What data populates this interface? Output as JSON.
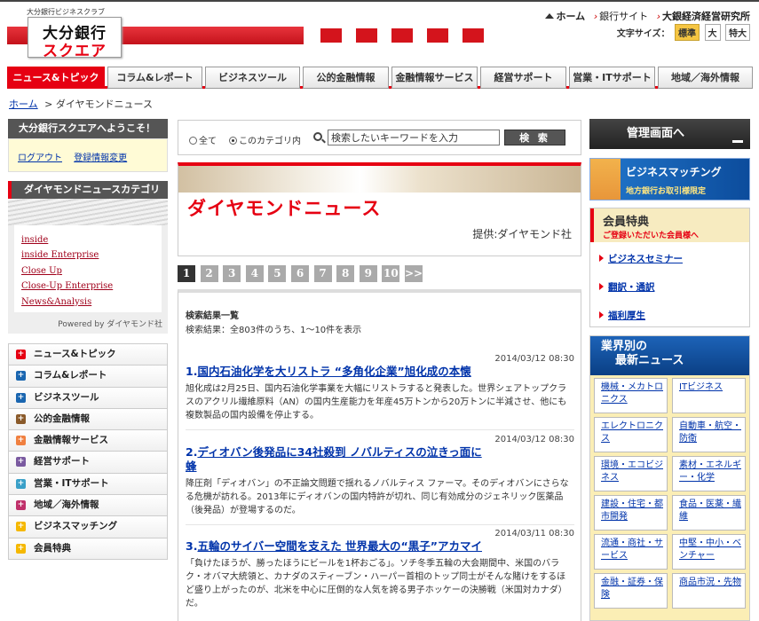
{
  "header": {
    "tagline": "大分銀行ビジネスクラブ",
    "logo_line1": "大分銀行",
    "logo_line2": "スクエア",
    "links": [
      "ホーム",
      "銀行サイト",
      "大銀経済経営研究所"
    ],
    "fontsize_label": "文字サイズ：",
    "fontsizes": [
      "標準",
      "大",
      "特大"
    ]
  },
  "gnav": [
    "ニュース&トピック",
    "コラム&レポート",
    "ビジネスツール",
    "公的金融情報",
    "金融情報サービス",
    "経営サポート",
    "営業・ITサポート",
    "地域／海外情報"
  ],
  "breadcrumb": {
    "home": "ホーム",
    "sep": ">",
    "current": "ダイヤモンドニュース"
  },
  "welcome": {
    "title": "大分銀行スクエアへようこそ！",
    "logout": "ログアウト",
    "edit": "登録情報変更"
  },
  "categories": {
    "title": "ダイヤモンドニュースカテゴリ",
    "items": [
      "inside",
      "inside Enterprise",
      "Close Up",
      "Close-Up Enterprise",
      "News&Analysis"
    ],
    "powered": "Powered by ダイヤモンド社"
  },
  "left_menu": [
    "ニュース&トピック",
    "コラム&レポート",
    "ビジネスツール",
    "公的金融情報",
    "金融情報サービス",
    "経営サポート",
    "営業・ITサポート",
    "地域／海外情報",
    "ビジネスマッチング",
    "会員特典"
  ],
  "colors": {
    "accent": "#e60012",
    "link": "#0033aa",
    "menu_icons": [
      "#e60012",
      "#1a66b0",
      "#1a66b0",
      "#8a5a2a",
      "#f08040",
      "#7a5aa0",
      "#3aa0c8",
      "#c0306a",
      "#f5b800",
      "#f5b800"
    ]
  },
  "search": {
    "all_label": "全て",
    "cat_label": "このカテゴリ内",
    "placeholder": "検索したいキーワードを入力",
    "button": "検 索"
  },
  "diamond": {
    "title": "ダイヤモンドニュース",
    "provider": "提供:ダイヤモンド社"
  },
  "pager": [
    "1",
    "2",
    "3",
    "4",
    "5",
    "6",
    "7",
    "8",
    "9",
    "10",
    ">>"
  ],
  "results": {
    "heading": "検索結果一覧",
    "count": "検索結果：全803件のうち、1～10件を表示",
    "items": [
      {
        "num": "1.",
        "date": "2014/03/12 08:30",
        "title": "国内石油化学を大リストラ “多角化企業”旭化成の本懐",
        "desc": "旭化成は2月25日、国内石油化学事業を大幅にリストラすると発表した。世界シェアトップクラスのアクリル繊維原料（AN）の国内生産能力を年産45万トンから20万トンに半減させ、他にも複数製品の国内設備を停止する。"
      },
      {
        "num": "2.",
        "date": "2014/03/12 08:30",
        "title": "ディオバン後発品に34社殺到 ノバルティスの泣きっ面に蜂",
        "desc": "降圧剤「ディオバン」の不正論文問題で揺れるノバルティス ファーマ。そのディオバンにさらなる危機が訪れる。2013年にディオバンの国内特許が切れ、同じ有効成分のジェネリック医薬品（後発品）が登場するのだ。"
      },
      {
        "num": "3.",
        "date": "2014/03/11 08:30",
        "title": "五輪のサイバー空間を支えた 世界最大の“黒子”アカマイ",
        "desc": "「負けたほうが、勝ったほうにビールを1杯おごる」。ソチ冬季五輪の大会期間中、米国のバラク・オバマ大統領と、カナダのスティーブン・ハーパー首相のトップ同士がそんな賭けをするほど盛り上がったのが、北米を中心に圧倒的な人気を誇る男子ホッケーの決勝戦（米国対カナダ）だ。"
      }
    ]
  },
  "right": {
    "admin": "管理画面へ",
    "matching_title": "ビジネスマッチング",
    "matching_sub": "地方銀行お取引様限定",
    "tokuten_title": "会員特典",
    "tokuten_sub": "ご登録いただいた会員様へ",
    "tokuten_links": [
      "ビジネスセミナー",
      "翻訳・通訳",
      "福利厚生"
    ],
    "industry_title_l1": "業界別の",
    "industry_title_l2": "最新ニュース",
    "industry": [
      "機械・メカトロニクス",
      "ITビジネス",
      "エレクトロニクス",
      "自動車・航空・防衛",
      "環境・エコビジネス",
      "素材・エネルギー・化学",
      "建設・住宅・都市開発",
      "食品・医薬・繊維",
      "流通・商社・サービス",
      "中堅・中小・ベンチャー",
      "金融・証券・保険",
      "商品市況・先物"
    ]
  }
}
